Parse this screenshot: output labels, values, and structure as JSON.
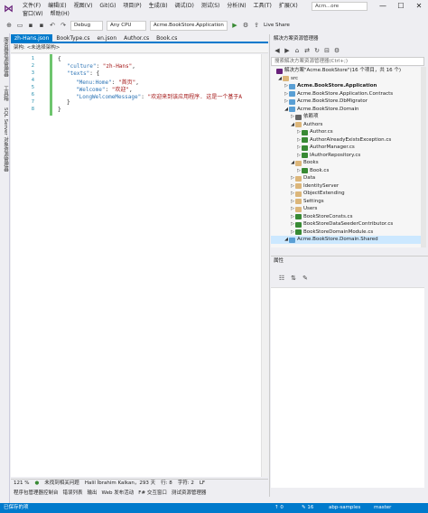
{
  "window": {
    "search_label": "Acm...ore",
    "menu": [
      "文件(F)",
      "编辑(E)",
      "视图(V)",
      "Git(G)",
      "项目(P)",
      "生成(B)",
      "调试(D)",
      "测试(S)",
      "分析(N)",
      "工具(T)",
      "扩展(X)",
      "窗口(W)",
      "帮助(H)"
    ],
    "controls": [
      "—",
      "☐",
      "✕"
    ]
  },
  "toolbar": {
    "config": "Debug",
    "platform": "Any CPU",
    "startup": "Acme.BookStore.Application",
    "live_share": "Live Share"
  },
  "left_strip": [
    "服务器资源管理器",
    "工具箱",
    "SQL Server 对象资源管理器"
  ],
  "editor": {
    "tabs": [
      {
        "label": "zh-Hans.json",
        "active": true
      },
      {
        "label": "BookType.cs",
        "active": false
      },
      {
        "label": "en.json",
        "active": false
      },
      {
        "label": "Author.cs",
        "active": false
      },
      {
        "label": "Book.cs",
        "active": false
      }
    ],
    "breadcrumb": "架构: <未选择架构>",
    "line_numbers": [
      "1",
      "2",
      "3",
      "4",
      "5",
      "6",
      "7",
      "8"
    ],
    "code": {
      "l1": "{",
      "l2_key": "\"culture\"",
      "l2_val": "\"zh-Hans\"",
      "l3_key": "\"texts\"",
      "l3_rest": ": {",
      "l4_key": "\"Menu:Home\"",
      "l4_val": "\"首页\"",
      "l5_key": "\"Welcome\"",
      "l5_val": "\"欢迎\"",
      "l6_key": "\"LongWelcomeMessage\"",
      "l6_val": "\"欢迎来到该应用程序. 这是一个基于A",
      "l7": "}",
      "l8": "}"
    },
    "status": {
      "zoom": "121 %",
      "issues": "未找到相关问题",
      "author": "Halil İbrahim Kalkan，293 天",
      "line": "行: 8",
      "char": "字符: 2",
      "encoding": "LF"
    }
  },
  "bottom_tabs": [
    "程序包管理器控制台",
    "错误列表",
    "输出",
    "Web 发布活动",
    "F# 交互窗口",
    "测试资源管理器"
  ],
  "solution_explorer": {
    "title": "解决方案资源管理器",
    "search_placeholder": "搜索解决方案资源管理器(Ctrl+;)",
    "items": [
      {
        "label": "解决方案\"Acme.BookStore\"(16 个项目，共 16 个)",
        "indent": 0,
        "icon": "sol",
        "arrow": ""
      },
      {
        "label": "src",
        "indent": 1,
        "icon": "folder",
        "arrow": "◢"
      },
      {
        "label": "Acme.BookStore.Application",
        "indent": 2,
        "icon": "proj",
        "arrow": "▷",
        "bold": true
      },
      {
        "label": "Acme.BookStore.Application.Contracts",
        "indent": 2,
        "icon": "proj",
        "arrow": "▷"
      },
      {
        "label": "Acme.BookStore.DbMigrator",
        "indent": 2,
        "icon": "proj",
        "arrow": "▷"
      },
      {
        "label": "Acme.BookStore.Domain",
        "indent": 2,
        "icon": "proj",
        "arrow": "◢"
      },
      {
        "label": "依赖项",
        "indent": 3,
        "icon": "dep",
        "arrow": "▷"
      },
      {
        "label": "Authors",
        "indent": 3,
        "icon": "folder",
        "arrow": "◢"
      },
      {
        "label": "Author.cs",
        "indent": 4,
        "icon": "cs",
        "arrow": "▷"
      },
      {
        "label": "AuthorAlreadyExistsException.cs",
        "indent": 4,
        "icon": "cs",
        "arrow": "▷"
      },
      {
        "label": "AuthorManager.cs",
        "indent": 4,
        "icon": "cs",
        "arrow": "▷"
      },
      {
        "label": "IAuthorRepository.cs",
        "indent": 4,
        "icon": "cs",
        "arrow": "▷"
      },
      {
        "label": "Books",
        "indent": 3,
        "icon": "folder",
        "arrow": "◢"
      },
      {
        "label": "Book.cs",
        "indent": 4,
        "icon": "cs",
        "arrow": "▷"
      },
      {
        "label": "Data",
        "indent": 3,
        "icon": "folder",
        "arrow": "▷"
      },
      {
        "label": "IdentityServer",
        "indent": 3,
        "icon": "folder",
        "arrow": "▷"
      },
      {
        "label": "ObjectExtending",
        "indent": 3,
        "icon": "folder",
        "arrow": "▷"
      },
      {
        "label": "Settings",
        "indent": 3,
        "icon": "folder",
        "arrow": "▷"
      },
      {
        "label": "Users",
        "indent": 3,
        "icon": "folder",
        "arrow": "▷"
      },
      {
        "label": "BookStoreConsts.cs",
        "indent": 3,
        "icon": "cs",
        "arrow": "▷"
      },
      {
        "label": "BookStoreDataSeederContributor.cs",
        "indent": 3,
        "icon": "cs",
        "arrow": "▷"
      },
      {
        "label": "BookStoreDomainModule.cs",
        "indent": 3,
        "icon": "cs",
        "arrow": "▷"
      },
      {
        "label": "Acme.BookStore.Domain.Shared",
        "indent": 2,
        "icon": "proj",
        "arrow": "◢",
        "selected": true
      }
    ]
  },
  "properties": {
    "title": "属性"
  },
  "statusbar": {
    "left": "已保存的项",
    "errors_up": "↑ 0",
    "pencil": "✎ 16",
    "branch_repo": "abp-samples",
    "branch": "master"
  },
  "colors": {
    "accent": "#007acc",
    "json_key": "#2e75b6",
    "json_value": "#a31515"
  }
}
